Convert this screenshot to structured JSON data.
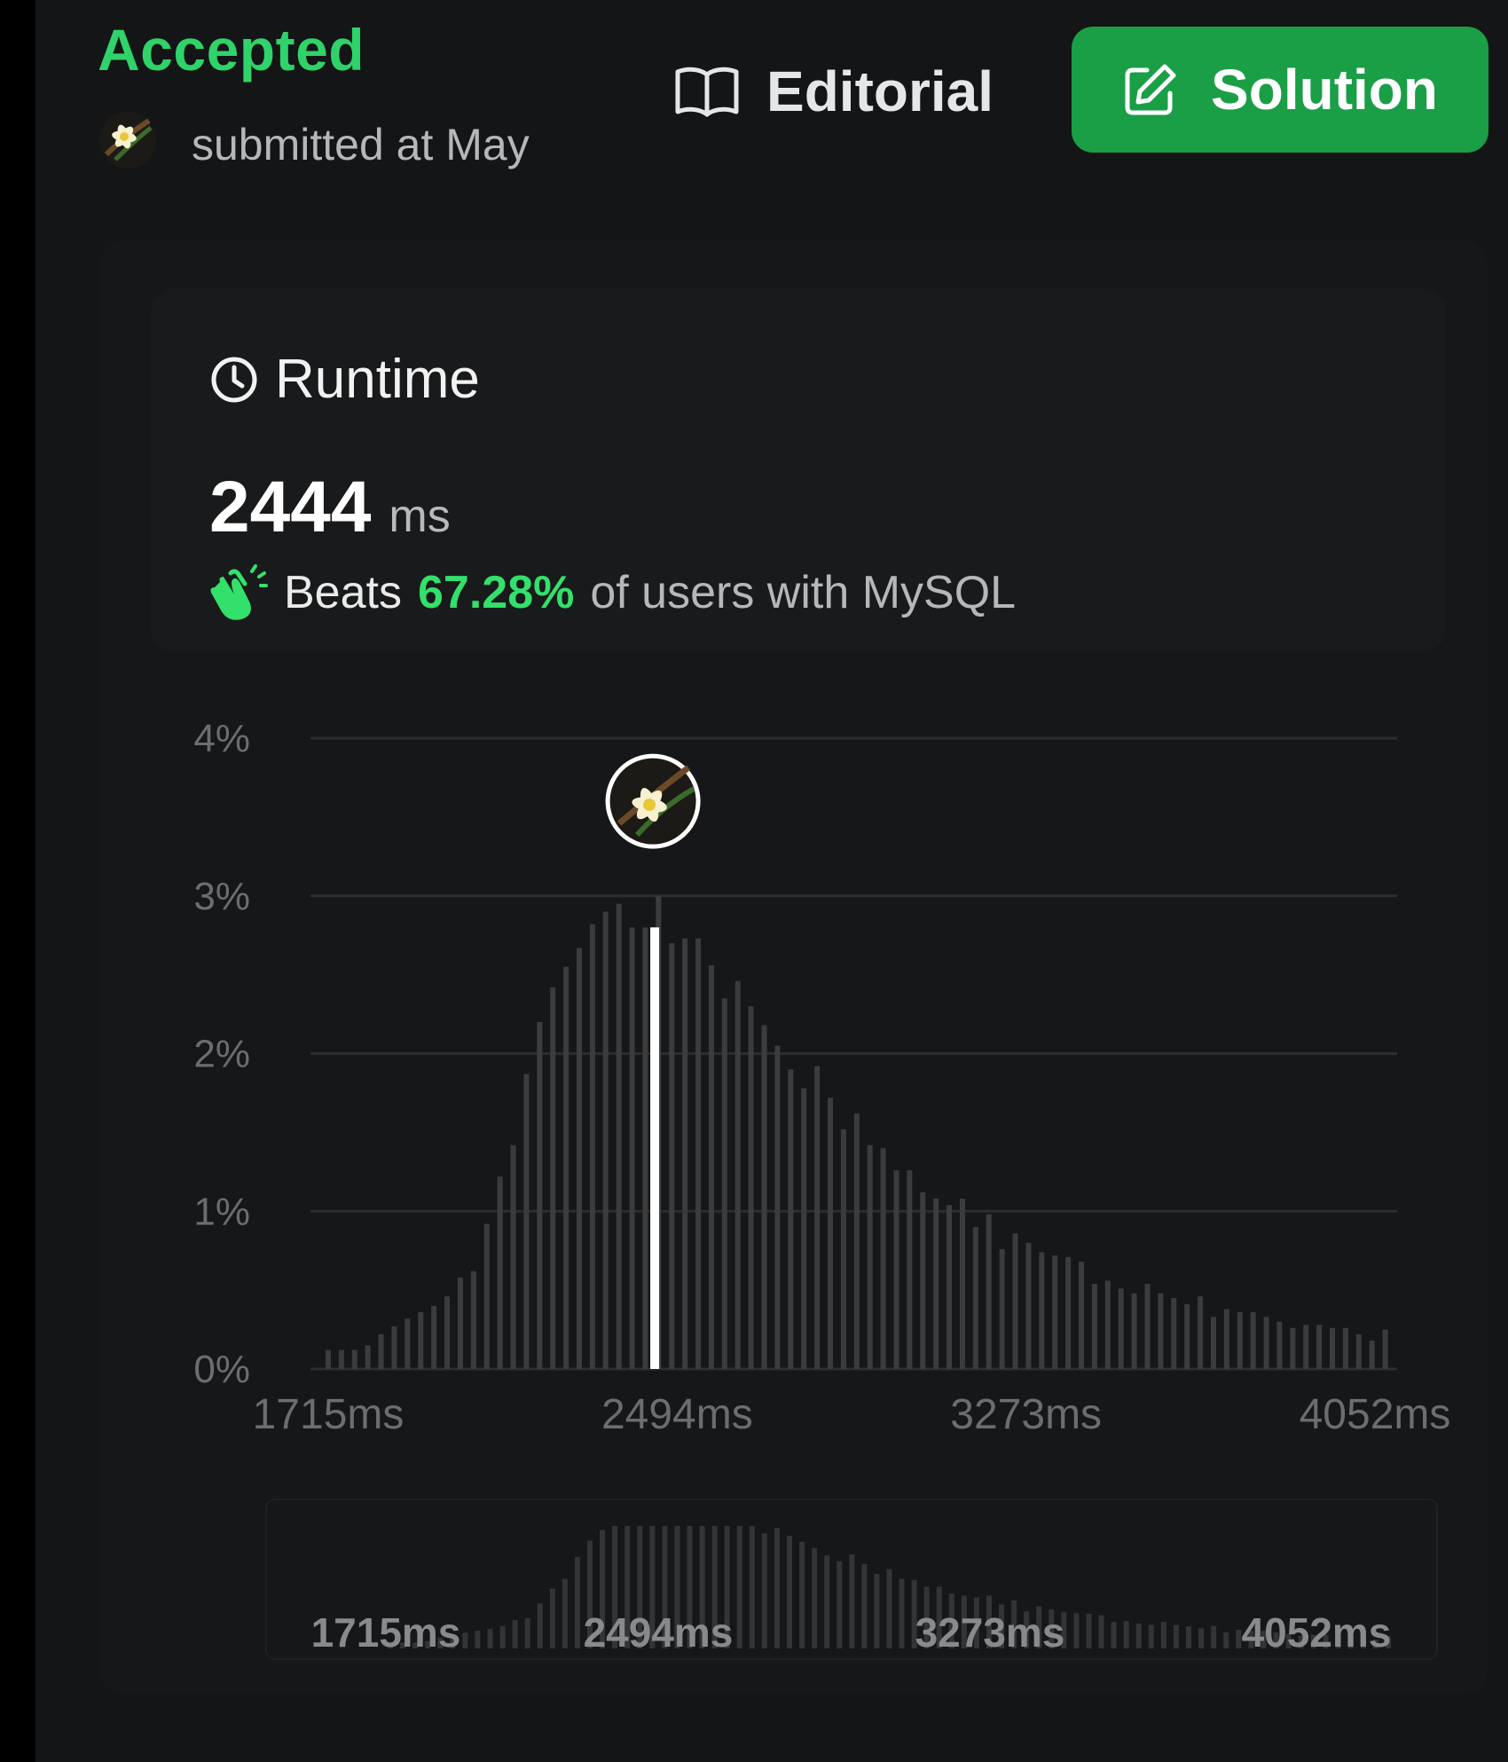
{
  "header": {
    "status": "Accepted",
    "submitted_text": "submitted at May",
    "editorial_label": "Editorial",
    "solution_label": "Solution"
  },
  "runtime": {
    "title": "Runtime",
    "value": "2444",
    "unit": "ms",
    "beats_prefix": "Beats",
    "beats_percent": "67.28%",
    "beats_suffix": "of users with MySQL"
  },
  "colors": {
    "accent_green": "#2fd36a",
    "button_green": "#1a9e46",
    "bar": "#3b3c3d",
    "highlight_bar": "#ffffff"
  },
  "icons": [
    "vanilla-flower-avatar-icon",
    "book-icon",
    "edit-icon",
    "clock-icon",
    "clapping-hands-icon"
  ],
  "chart_data": {
    "type": "bar",
    "title": "",
    "xlabel": "",
    "ylabel": "",
    "y_unit": "%",
    "ylim": [
      0,
      4
    ],
    "yticks": [
      "0%",
      "1%",
      "2%",
      "3%",
      "4%"
    ],
    "xlim": [
      1715,
      4052
    ],
    "xticks": [
      "1715ms",
      "2494ms",
      "3273ms",
      "4052ms"
    ],
    "grid": true,
    "bin_start_ms": 1715,
    "bin_width_ms": 29.5,
    "highlight_value_ms": 2444,
    "highlight_percent": 2.8,
    "values": [
      0.12,
      0.12,
      0.12,
      0.15,
      0.22,
      0.27,
      0.32,
      0.36,
      0.4,
      0.46,
      0.58,
      0.62,
      0.92,
      1.22,
      1.42,
      1.87,
      2.2,
      2.42,
      2.55,
      2.67,
      2.82,
      2.9,
      2.95,
      2.8,
      2.8,
      3.0,
      2.7,
      2.73,
      2.73,
      2.56,
      2.35,
      2.46,
      2.3,
      2.18,
      2.05,
      1.9,
      1.78,
      1.92,
      1.72,
      1.52,
      1.62,
      1.42,
      1.4,
      1.26,
      1.26,
      1.12,
      1.08,
      1.04,
      1.08,
      0.9,
      0.98,
      0.76,
      0.86,
      0.8,
      0.74,
      0.72,
      0.71,
      0.68,
      0.54,
      0.56,
      0.51,
      0.48,
      0.54,
      0.48,
      0.45,
      0.41,
      0.46,
      0.33,
      0.38,
      0.36,
      0.36,
      0.33,
      0.3,
      0.26,
      0.28,
      0.28,
      0.26,
      0.26,
      0.22,
      0.18,
      0.25
    ],
    "overview_xticks": [
      "1715ms",
      "2494ms",
      "3273ms",
      "4052ms"
    ]
  }
}
